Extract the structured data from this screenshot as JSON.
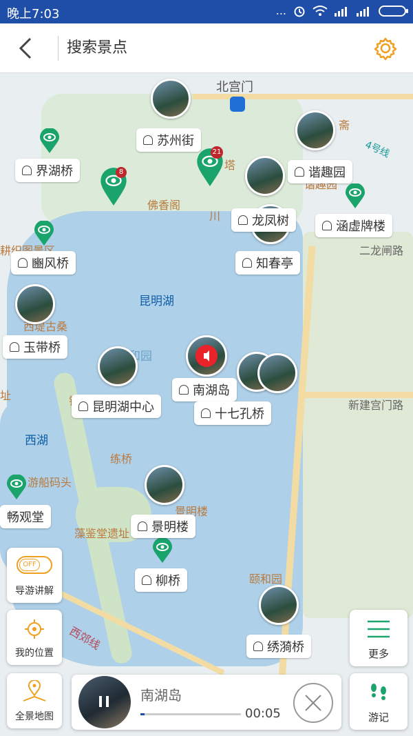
{
  "status_bar": {
    "time": "晚上7:03",
    "signal_dots": "...",
    "icons": [
      "alarm-icon",
      "wifi-icon",
      "signal-icon",
      "signal-icon",
      "battery-icon"
    ]
  },
  "header": {
    "back_icon": "chevron-left-icon",
    "search_placeholder": "搜索景点",
    "settings_icon": "gear-icon",
    "accent_color": "#f0a020"
  },
  "map": {
    "area_labels": [
      "北宫门",
      "昆明湖",
      "西湖",
      "佛香阁",
      "谐趣园",
      "二龙闸路",
      "新建宫门路",
      "颐和园",
      "景明楼",
      "练桥",
      "游船码头",
      "藻鉴堂遗址",
      "西郊线",
      "耕织图景区",
      "西堤古桑",
      "颐和园",
      "川",
      "塔",
      "斋",
      "镜",
      "址",
      "4号线"
    ],
    "spots": [
      {
        "name": "苏州街"
      },
      {
        "name": "界湖桥"
      },
      {
        "name": "谐趣园"
      },
      {
        "name": "龙凤树"
      },
      {
        "name": "涵虚牌楼"
      },
      {
        "name": "豳风桥"
      },
      {
        "name": "知春亭"
      },
      {
        "name": "玉带桥"
      },
      {
        "name": "南湖岛"
      },
      {
        "name": "昆明湖中心"
      },
      {
        "name": "十七孔桥"
      },
      {
        "name": "景明楼"
      },
      {
        "name": "畅观堂"
      },
      {
        "name": "柳桥"
      },
      {
        "name": "绣漪桥"
      }
    ],
    "pin_counts": [
      "8",
      "21"
    ]
  },
  "controls": {
    "guide": {
      "label": "导游讲解",
      "toggle": "OFF"
    },
    "location": {
      "label": "我的位置"
    },
    "overview": {
      "label": "全景地图"
    },
    "more": {
      "label": "更多"
    },
    "notes": {
      "label": "游记"
    }
  },
  "player": {
    "title": "南湖岛",
    "elapsed": "00:05",
    "progress": 0.04
  },
  "colors": {
    "status_bar": "#1f4ea8",
    "pin_green": "#1aa36b",
    "water": "#aed0e8",
    "land_green": "#dcebd9",
    "playing_red": "#e8232a"
  }
}
